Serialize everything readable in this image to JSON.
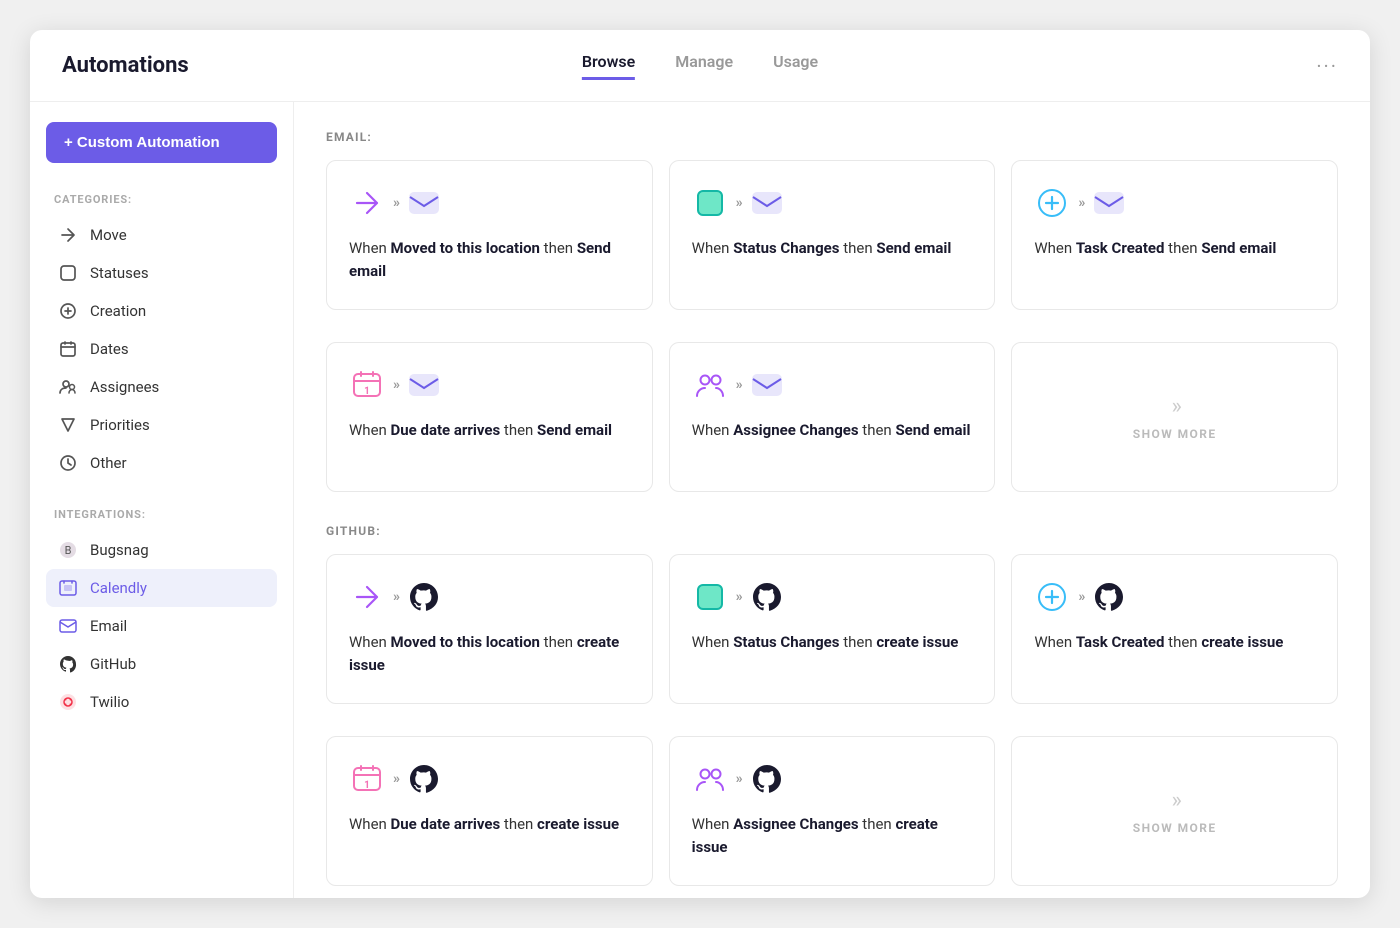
{
  "header": {
    "title": "Automations",
    "tabs": [
      {
        "label": "Browse",
        "active": true
      },
      {
        "label": "Manage",
        "active": false
      },
      {
        "label": "Usage",
        "active": false
      }
    ],
    "dots": "···"
  },
  "sidebar": {
    "custom_button": "+ Custom Automation",
    "categories_label": "CATEGORIES:",
    "categories": [
      {
        "name": "Move",
        "icon": "move"
      },
      {
        "name": "Statuses",
        "icon": "statuses"
      },
      {
        "name": "Creation",
        "icon": "creation"
      },
      {
        "name": "Dates",
        "icon": "dates"
      },
      {
        "name": "Assignees",
        "icon": "assignees"
      },
      {
        "name": "Priorities",
        "icon": "priorities"
      },
      {
        "name": "Other",
        "icon": "other"
      }
    ],
    "integrations_label": "INTEGRATIONS:",
    "integrations": [
      {
        "name": "Bugsnag",
        "icon": "bugsnag",
        "active": false
      },
      {
        "name": "Calendly",
        "icon": "calendly",
        "active": true
      },
      {
        "name": "Email",
        "icon": "email",
        "active": false
      },
      {
        "name": "GitHub",
        "icon": "github",
        "active": false
      },
      {
        "name": "Twilio",
        "icon": "twilio",
        "active": false
      }
    ]
  },
  "sections": [
    {
      "label": "EMAIL:",
      "rows": [
        [
          {
            "type": "card",
            "trigger_icon": "move-purple",
            "action_icon": "email-action",
            "text_pre": "When ",
            "text_bold1": "Moved to this location",
            "text_mid": " then ",
            "text_bold2": "Send email"
          },
          {
            "type": "card",
            "trigger_icon": "status-teal",
            "action_icon": "email-action",
            "text_pre": "When ",
            "text_bold1": "Status Changes",
            "text_mid": " then ",
            "text_bold2": "Send email"
          },
          {
            "type": "card",
            "trigger_icon": "creation-blue",
            "action_icon": "email-action",
            "text_pre": "When ",
            "text_bold1": "Task Created",
            "text_mid": " then ",
            "text_bold2": "Send email"
          }
        ],
        [
          {
            "type": "card",
            "trigger_icon": "date-pink",
            "action_icon": "email-action",
            "text_pre": "When ",
            "text_bold1": "Due date arrives",
            "text_mid": " then ",
            "text_bold2": "Send email"
          },
          {
            "type": "card",
            "trigger_icon": "assignee-purple",
            "action_icon": "email-action",
            "text_pre": "When ",
            "text_bold1": "Assignee Changes",
            "text_mid": " then ",
            "text_bold2": "Send email"
          },
          {
            "type": "show-more",
            "label": "SHOW MORE"
          }
        ]
      ]
    },
    {
      "label": "GITHUB:",
      "rows": [
        [
          {
            "type": "card",
            "trigger_icon": "move-purple",
            "action_icon": "github-action",
            "text_pre": "When ",
            "text_bold1": "Moved to this location",
            "text_mid": " then ",
            "text_bold2": "create issue"
          },
          {
            "type": "card",
            "trigger_icon": "status-teal",
            "action_icon": "github-action",
            "text_pre": "When ",
            "text_bold1": "Status Changes",
            "text_mid": " then ",
            "text_bold2": "create issue"
          },
          {
            "type": "card",
            "trigger_icon": "creation-blue",
            "action_icon": "github-action",
            "text_pre": "When ",
            "text_bold1": "Task Created",
            "text_mid": " then ",
            "text_bold2": "create issue"
          }
        ],
        [
          {
            "type": "card",
            "trigger_icon": "date-pink",
            "action_icon": "github-action",
            "text_pre": "When ",
            "text_bold1": "Due date arrives",
            "text_mid": " then ",
            "text_bold2": "create issue"
          },
          {
            "type": "card",
            "trigger_icon": "assignee-purple",
            "action_icon": "github-action",
            "text_pre": "When ",
            "text_bold1": "Assignee Changes",
            "text_mid": " then ",
            "text_bold2": "create issue"
          },
          {
            "type": "show-more",
            "label": "SHOW MORE"
          }
        ]
      ]
    }
  ]
}
